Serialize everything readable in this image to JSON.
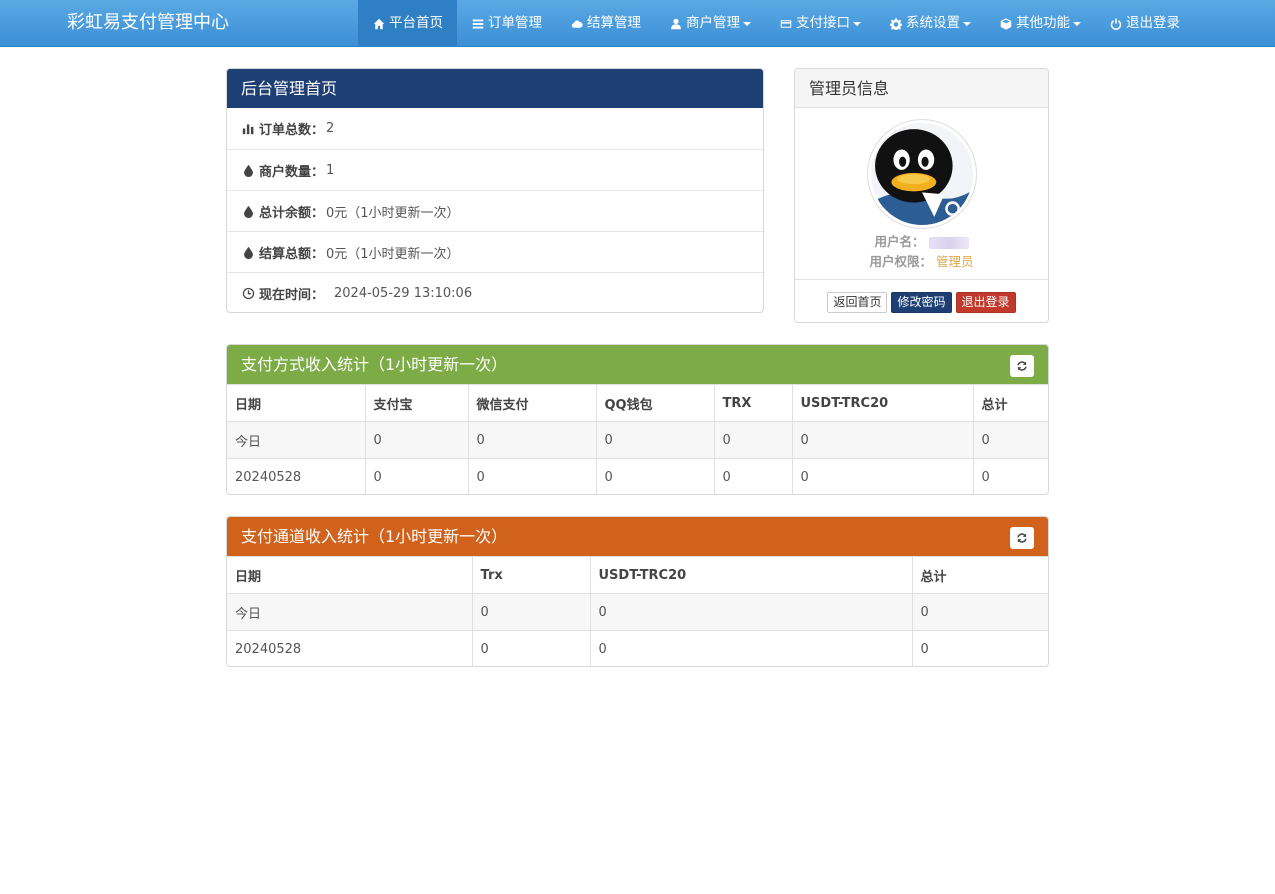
{
  "navbar": {
    "brand": "彩虹易支付管理中心",
    "items": [
      {
        "label": "平台首页",
        "icon": "home-icon"
      },
      {
        "label": "订单管理",
        "icon": "list-icon"
      },
      {
        "label": "结算管理",
        "icon": "cloud-icon"
      },
      {
        "label": "商户管理",
        "icon": "user-icon"
      },
      {
        "label": "支付接口",
        "icon": "credit-card-icon"
      },
      {
        "label": "系统设置",
        "icon": "gear-icon"
      },
      {
        "label": "其他功能",
        "icon": "cube-icon"
      },
      {
        "label": "退出登录",
        "icon": "power-icon"
      }
    ]
  },
  "overview": {
    "title": "后台管理首页",
    "rows": [
      {
        "label": "订单总数：",
        "value": "2",
        "icon": "bar-chart-icon"
      },
      {
        "label": "商户数量：",
        "value": "1",
        "icon": "drop-icon"
      },
      {
        "label": "总计余额：",
        "value": "0元（1小时更新一次）",
        "icon": "drop-icon"
      },
      {
        "label": "结算总额：",
        "value": "0元（1小时更新一次）",
        "icon": "drop-icon"
      },
      {
        "label": "现在时间：",
        "value": "2024-05-29 13:10:06",
        "icon": "clock-icon"
      }
    ]
  },
  "admin": {
    "title": "管理员信息",
    "username_label": "用户名：",
    "role_label": "用户权限：",
    "role_value": "管理员",
    "buttons": {
      "home": "返回首页",
      "password": "修改密码",
      "logout": "退出登录"
    }
  },
  "method_stats": {
    "title": "支付方式收入统计（1小时更新一次）",
    "headers": [
      "日期",
      "支付宝",
      "微信支付",
      "QQ钱包",
      "TRX",
      "USDT-TRC20",
      "总计"
    ],
    "rows": [
      [
        "今日",
        "0",
        "0",
        "0",
        "0",
        "0",
        "0"
      ],
      [
        "20240528",
        "0",
        "0",
        "0",
        "0",
        "0",
        "0"
      ]
    ]
  },
  "channel_stats": {
    "title": "支付通道收入统计（1小时更新一次）",
    "headers": [
      "日期",
      "Trx",
      "USDT-TRC20",
      "总计"
    ],
    "rows": [
      [
        "今日",
        "0",
        "0",
        "0"
      ],
      [
        "20240528",
        "0",
        "0",
        "0"
      ]
    ]
  },
  "colors": {
    "navbar": "#4a9fe0",
    "overview_head": "#1d3f73",
    "method_head": "#7dac46",
    "channel_head": "#d0621c",
    "role": "#e0a64b"
  }
}
